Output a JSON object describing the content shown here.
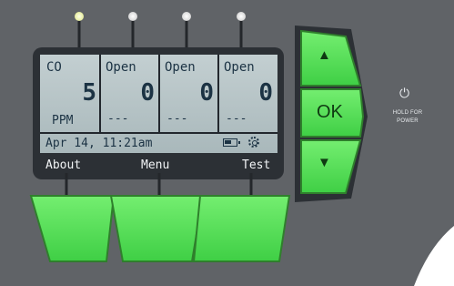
{
  "colors": {
    "panel": "#606367",
    "frame": "#2c3035",
    "lcd_bg": "#b7c4c7",
    "lcd_text": "#1c3344",
    "button_green": "#5ee05e",
    "button_edge": "#2f7f2c",
    "led_on": "#f2f5c9",
    "led_off": "#f4f4f4"
  },
  "leds": [
    {
      "name": "led-1",
      "state": "on-yellow"
    },
    {
      "name": "led-2",
      "state": "white"
    },
    {
      "name": "led-3",
      "state": "white"
    },
    {
      "name": "led-4",
      "state": "white"
    }
  ],
  "channels": [
    {
      "label": "CO",
      "value": "5",
      "unit": "PPM"
    },
    {
      "label": "Open",
      "value": "0",
      "unit": "---"
    },
    {
      "label": "Open",
      "value": "0",
      "unit": "---"
    },
    {
      "label": "Open",
      "value": "0",
      "unit": "---"
    }
  ],
  "status": {
    "datetime": "Apr 14, 11:21am",
    "battery_icon": "battery-icon",
    "settings_icon": "gear-icon"
  },
  "softkeys": [
    "About",
    "Menu",
    "Test"
  ],
  "nav": {
    "up_icon": "up-arrow-icon",
    "up_glyph": "▲",
    "ok_label": "OK",
    "down_icon": "down-arrow-icon",
    "down_glyph": "▼"
  },
  "power": {
    "icon": "power-icon",
    "glyph": "⏻",
    "line1": "HOLD FOR",
    "line2": "POWER"
  }
}
